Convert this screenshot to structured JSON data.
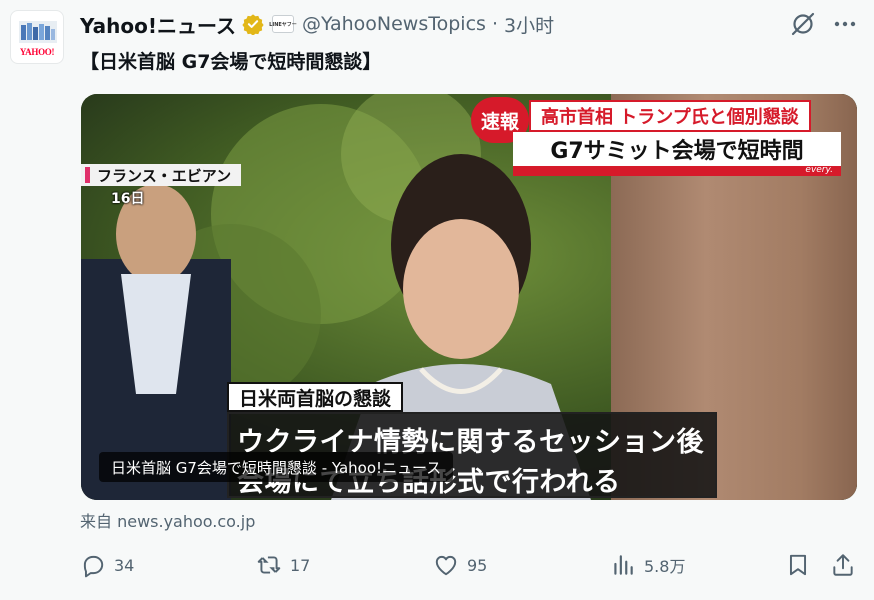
{
  "account": {
    "display_name": "Yahoo!ニュース",
    "handle": "@YahooNewsTopics",
    "separator": "·",
    "time": "3小时",
    "avatar_brand": "YAHOO!",
    "affiliate_badge": "LINEヤフー",
    "verified_color": "#e2b719"
  },
  "tweet": {
    "text": "【日米首脳 G7会場で短時間懇談】"
  },
  "media": {
    "badge": "速報",
    "headline_top": "高市首相 トランプ氏と個別懇談",
    "headline_bottom": "G7サミット会場で短時間",
    "program": "every.",
    "location": "フランス・エビアン",
    "date": "16日",
    "caption_small": "日米両首脳の懇談",
    "caption_line1": "ウクライナ情勢に関するセッション後",
    "caption_line2": "会場にて立ち話形式で行われる",
    "card_title": "日米首脳 G7会場で短時間懇談 - Yahoo!ニュース"
  },
  "source": {
    "label": "来自 news.yahoo.co.jp"
  },
  "actions": {
    "reply_icon": "reply-icon",
    "reply_count": "34",
    "retweet_icon": "retweet-icon",
    "retweet_count": "17",
    "like_icon": "heart-icon",
    "like_count": "95",
    "views_icon": "views-icon",
    "views_count": "5.8万",
    "bookmark_icon": "bookmark-icon",
    "share_icon": "share-icon"
  },
  "colors": {
    "text_primary": "#0f1419",
    "text_secondary": "#536471",
    "breaking_red": "#d61a2a",
    "background": "#f7f9f9"
  }
}
